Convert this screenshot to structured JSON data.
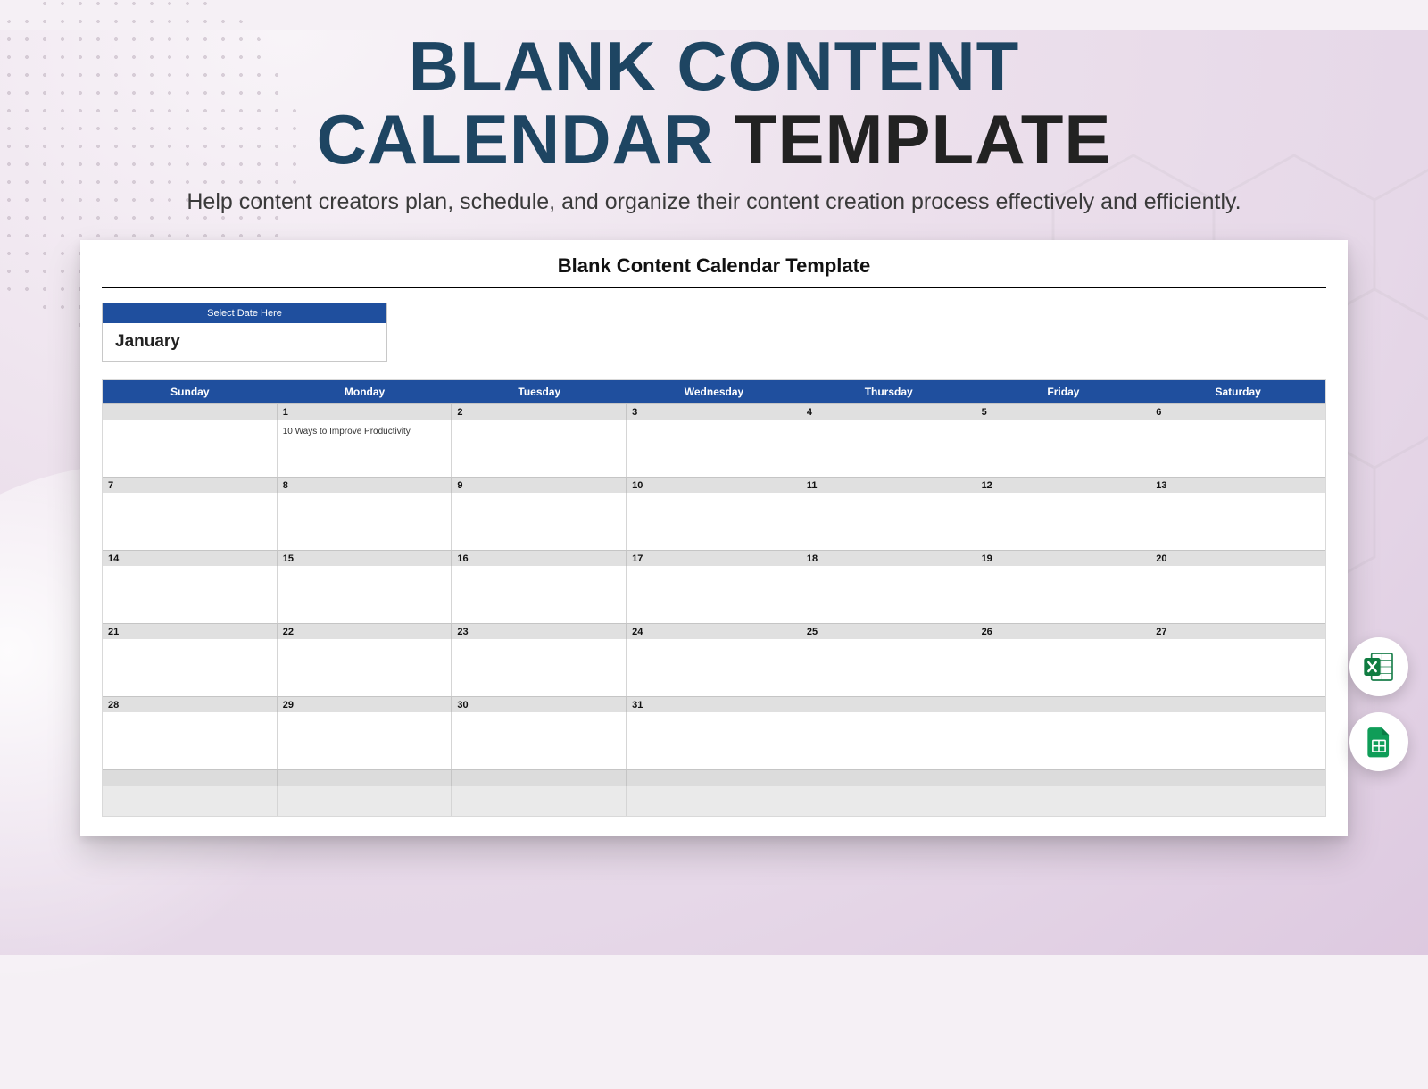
{
  "title": {
    "line1": "BLANK CONTENT",
    "line2a": "CALENDAR ",
    "line2b": "TEMPLATE"
  },
  "subtitle": "Help content creators plan, schedule, and organize their content creation process effectively and efficiently.",
  "card": {
    "title": "Blank Content Calendar Template",
    "select_label": "Select Date Here",
    "month": "January"
  },
  "days": [
    "Sunday",
    "Monday",
    "Tuesday",
    "Wednesday",
    "Thursday",
    "Friday",
    "Saturday"
  ],
  "weeks": [
    {
      "dates": [
        "",
        "1",
        "2",
        "3",
        "4",
        "5",
        "6"
      ],
      "cells": [
        "",
        "10 Ways to Improve Productivity",
        "",
        "",
        "",
        "",
        ""
      ]
    },
    {
      "dates": [
        "7",
        "8",
        "9",
        "10",
        "11",
        "12",
        "13"
      ],
      "cells": [
        "",
        "",
        "",
        "",
        "",
        "",
        ""
      ]
    },
    {
      "dates": [
        "14",
        "15",
        "16",
        "17",
        "18",
        "19",
        "20"
      ],
      "cells": [
        "",
        "",
        "",
        "",
        "",
        "",
        ""
      ]
    },
    {
      "dates": [
        "21",
        "22",
        "23",
        "24",
        "25",
        "26",
        "27"
      ],
      "cells": [
        "",
        "",
        "",
        "",
        "",
        "",
        ""
      ]
    },
    {
      "dates": [
        "28",
        "29",
        "30",
        "31",
        "",
        "",
        ""
      ],
      "cells": [
        "",
        "",
        "",
        "",
        "",
        "",
        ""
      ]
    },
    {
      "dates": [
        "",
        "",
        "",
        "",
        "",
        "",
        ""
      ],
      "cells": [
        "",
        "",
        "",
        "",
        "",
        "",
        ""
      ]
    }
  ],
  "colors": {
    "brand_blue": "#1f4f9e",
    "title_dark": "#1e4562"
  },
  "side_icons": [
    "excel-icon",
    "google-sheets-icon"
  ]
}
